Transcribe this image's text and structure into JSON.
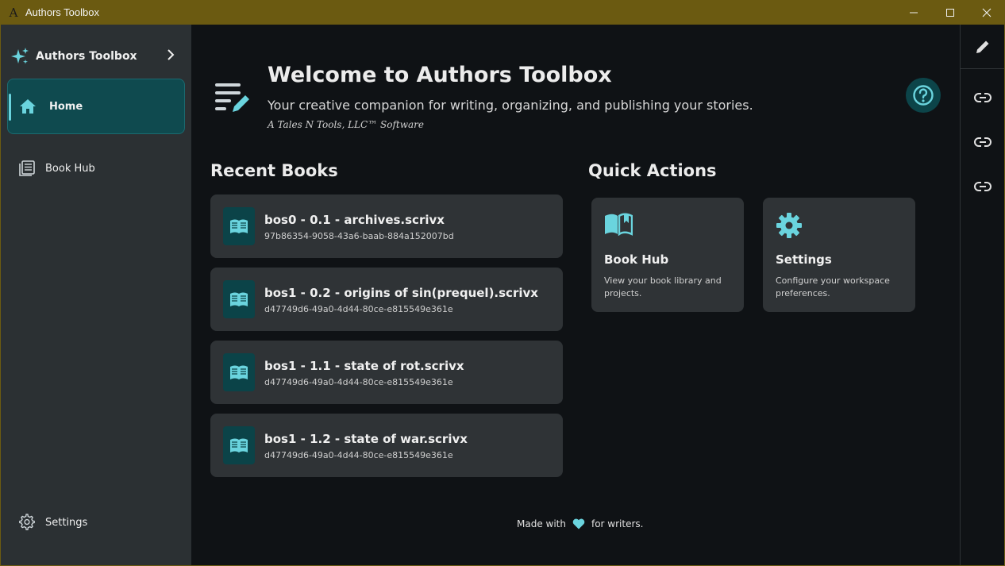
{
  "window": {
    "title": "Authors Toolbox",
    "logo_glyph": "A"
  },
  "sidebar": {
    "brand_label": "Authors Toolbox",
    "items": [
      {
        "label": "Home",
        "icon": "home-icon",
        "selected": true
      },
      {
        "label": "Book Hub",
        "icon": "book-library-icon",
        "selected": false
      }
    ],
    "footer_item": {
      "label": "Settings",
      "icon": "gear-icon"
    }
  },
  "header": {
    "title": "Welcome to Authors Toolbox",
    "subtitle": "Your creative companion for writing, organizing, and publishing your stories.",
    "tagline": "A Tales N Tools, LLC™ Software"
  },
  "recent_books": {
    "title": "Recent Books",
    "items": [
      {
        "name": "bos0 - 0.1 - archives.scrivx",
        "id": "97b86354-9058-43a6-baab-884a152007bd"
      },
      {
        "name": "bos1 - 0.2 - origins of sin(prequel).scrivx",
        "id": "d47749d6-49a0-4d44-80ce-e815549e361e"
      },
      {
        "name": "bos1 - 1.1 - state of rot.scrivx",
        "id": "d47749d6-49a0-4d44-80ce-e815549e361e"
      },
      {
        "name": "bos1 - 1.2 - state of war.scrivx",
        "id": "d47749d6-49a0-4d44-80ce-e815549e361e"
      }
    ]
  },
  "quick_actions": {
    "title": "Quick Actions",
    "items": [
      {
        "title": "Book Hub",
        "description": "View your book library and projects.",
        "icon": "open-book-icon"
      },
      {
        "title": "Settings",
        "description": "Configure your workspace preferences.",
        "icon": "gear-icon"
      }
    ]
  },
  "footer": {
    "prefix": "Made with",
    "suffix": "for writers."
  },
  "colors": {
    "titlebar": "#6b5a11",
    "accent": "#6ad4de",
    "sidebar_bg": "#2b3033",
    "card_bg": "#2f3336",
    "selected_bg": "#0f4a4f",
    "main_bg": "#0f1215"
  }
}
